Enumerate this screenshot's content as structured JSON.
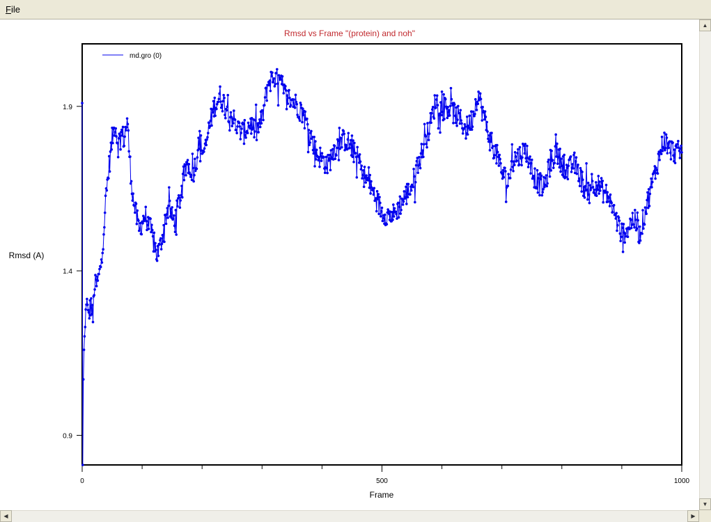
{
  "menu": {
    "file_label": "File"
  },
  "chart_data": {
    "type": "line",
    "title": "Rmsd vs Frame \"(protein) and noh\"",
    "xlabel": "Frame",
    "ylabel": "Rmsd (A)",
    "xlim": [
      0,
      1000
    ],
    "ylim": [
      0.81,
      2.09
    ],
    "xticks": [
      0,
      500,
      1000
    ],
    "yticks": [
      0.9,
      1.4,
      1.9
    ],
    "grid": false,
    "legend": "top-left",
    "series": [
      {
        "name": "md.gro (0)",
        "color": "#0000ee",
        "markers": true,
        "keypoints": [
          [
            0,
            1.91
          ],
          [
            1,
            0.81
          ],
          [
            2,
            1.07
          ],
          [
            3,
            1.16
          ],
          [
            5,
            1.22
          ],
          [
            7,
            1.32
          ],
          [
            10,
            1.26
          ],
          [
            15,
            1.3
          ],
          [
            18,
            1.25
          ],
          [
            20,
            1.35
          ],
          [
            25,
            1.36
          ],
          [
            30,
            1.4
          ],
          [
            35,
            1.5
          ],
          [
            40,
            1.63
          ],
          [
            45,
            1.72
          ],
          [
            50,
            1.8
          ],
          [
            55,
            1.85
          ],
          [
            60,
            1.78
          ],
          [
            65,
            1.82
          ],
          [
            70,
            1.8
          ],
          [
            75,
            1.86
          ],
          [
            80,
            1.72
          ],
          [
            85,
            1.62
          ],
          [
            90,
            1.57
          ],
          [
            95,
            1.52
          ],
          [
            100,
            1.55
          ],
          [
            105,
            1.57
          ],
          [
            110,
            1.54
          ],
          [
            115,
            1.52
          ],
          [
            120,
            1.48
          ],
          [
            125,
            1.45
          ],
          [
            130,
            1.47
          ],
          [
            135,
            1.52
          ],
          [
            140,
            1.57
          ],
          [
            145,
            1.6
          ],
          [
            150,
            1.56
          ],
          [
            155,
            1.55
          ],
          [
            160,
            1.6
          ],
          [
            165,
            1.63
          ],
          [
            170,
            1.68
          ],
          [
            175,
            1.73
          ],
          [
            180,
            1.71
          ],
          [
            185,
            1.7
          ],
          [
            190,
            1.73
          ],
          [
            195,
            1.8
          ],
          [
            200,
            1.77
          ],
          [
            205,
            1.76
          ],
          [
            210,
            1.82
          ],
          [
            220,
            1.9
          ],
          [
            230,
            1.93
          ],
          [
            240,
            1.9
          ],
          [
            250,
            1.87
          ],
          [
            260,
            1.83
          ],
          [
            270,
            1.82
          ],
          [
            280,
            1.85
          ],
          [
            290,
            1.82
          ],
          [
            300,
            1.86
          ],
          [
            310,
            1.97
          ],
          [
            320,
            1.99
          ],
          [
            330,
            1.97
          ],
          [
            340,
            1.93
          ],
          [
            350,
            1.92
          ],
          [
            360,
            1.9
          ],
          [
            370,
            1.87
          ],
          [
            380,
            1.82
          ],
          [
            390,
            1.76
          ],
          [
            400,
            1.74
          ],
          [
            410,
            1.72
          ],
          [
            420,
            1.77
          ],
          [
            430,
            1.79
          ],
          [
            440,
            1.8
          ],
          [
            450,
            1.77
          ],
          [
            460,
            1.74
          ],
          [
            470,
            1.69
          ],
          [
            480,
            1.66
          ],
          [
            490,
            1.62
          ],
          [
            500,
            1.58
          ],
          [
            510,
            1.57
          ],
          [
            520,
            1.57
          ],
          [
            530,
            1.6
          ],
          [
            540,
            1.63
          ],
          [
            550,
            1.66
          ],
          [
            560,
            1.72
          ],
          [
            570,
            1.78
          ],
          [
            580,
            1.84
          ],
          [
            590,
            1.92
          ],
          [
            600,
            1.89
          ],
          [
            610,
            1.9
          ],
          [
            620,
            1.88
          ],
          [
            630,
            1.86
          ],
          [
            640,
            1.83
          ],
          [
            650,
            1.86
          ],
          [
            660,
            1.94
          ],
          [
            670,
            1.87
          ],
          [
            680,
            1.8
          ],
          [
            690,
            1.76
          ],
          [
            700,
            1.7
          ],
          [
            710,
            1.67
          ],
          [
            720,
            1.74
          ],
          [
            730,
            1.75
          ],
          [
            740,
            1.77
          ],
          [
            750,
            1.7
          ],
          [
            760,
            1.67
          ],
          [
            770,
            1.65
          ],
          [
            780,
            1.72
          ],
          [
            790,
            1.76
          ],
          [
            800,
            1.73
          ],
          [
            810,
            1.7
          ],
          [
            820,
            1.73
          ],
          [
            830,
            1.69
          ],
          [
            840,
            1.64
          ],
          [
            850,
            1.67
          ],
          [
            860,
            1.66
          ],
          [
            870,
            1.64
          ],
          [
            880,
            1.62
          ],
          [
            890,
            1.56
          ],
          [
            900,
            1.51
          ],
          [
            910,
            1.53
          ],
          [
            920,
            1.56
          ],
          [
            930,
            1.51
          ],
          [
            940,
            1.59
          ],
          [
            950,
            1.66
          ],
          [
            960,
            1.73
          ],
          [
            970,
            1.8
          ],
          [
            980,
            1.77
          ],
          [
            990,
            1.76
          ],
          [
            1000,
            1.76
          ]
        ],
        "noise_amplitude": 0.035
      }
    ]
  }
}
